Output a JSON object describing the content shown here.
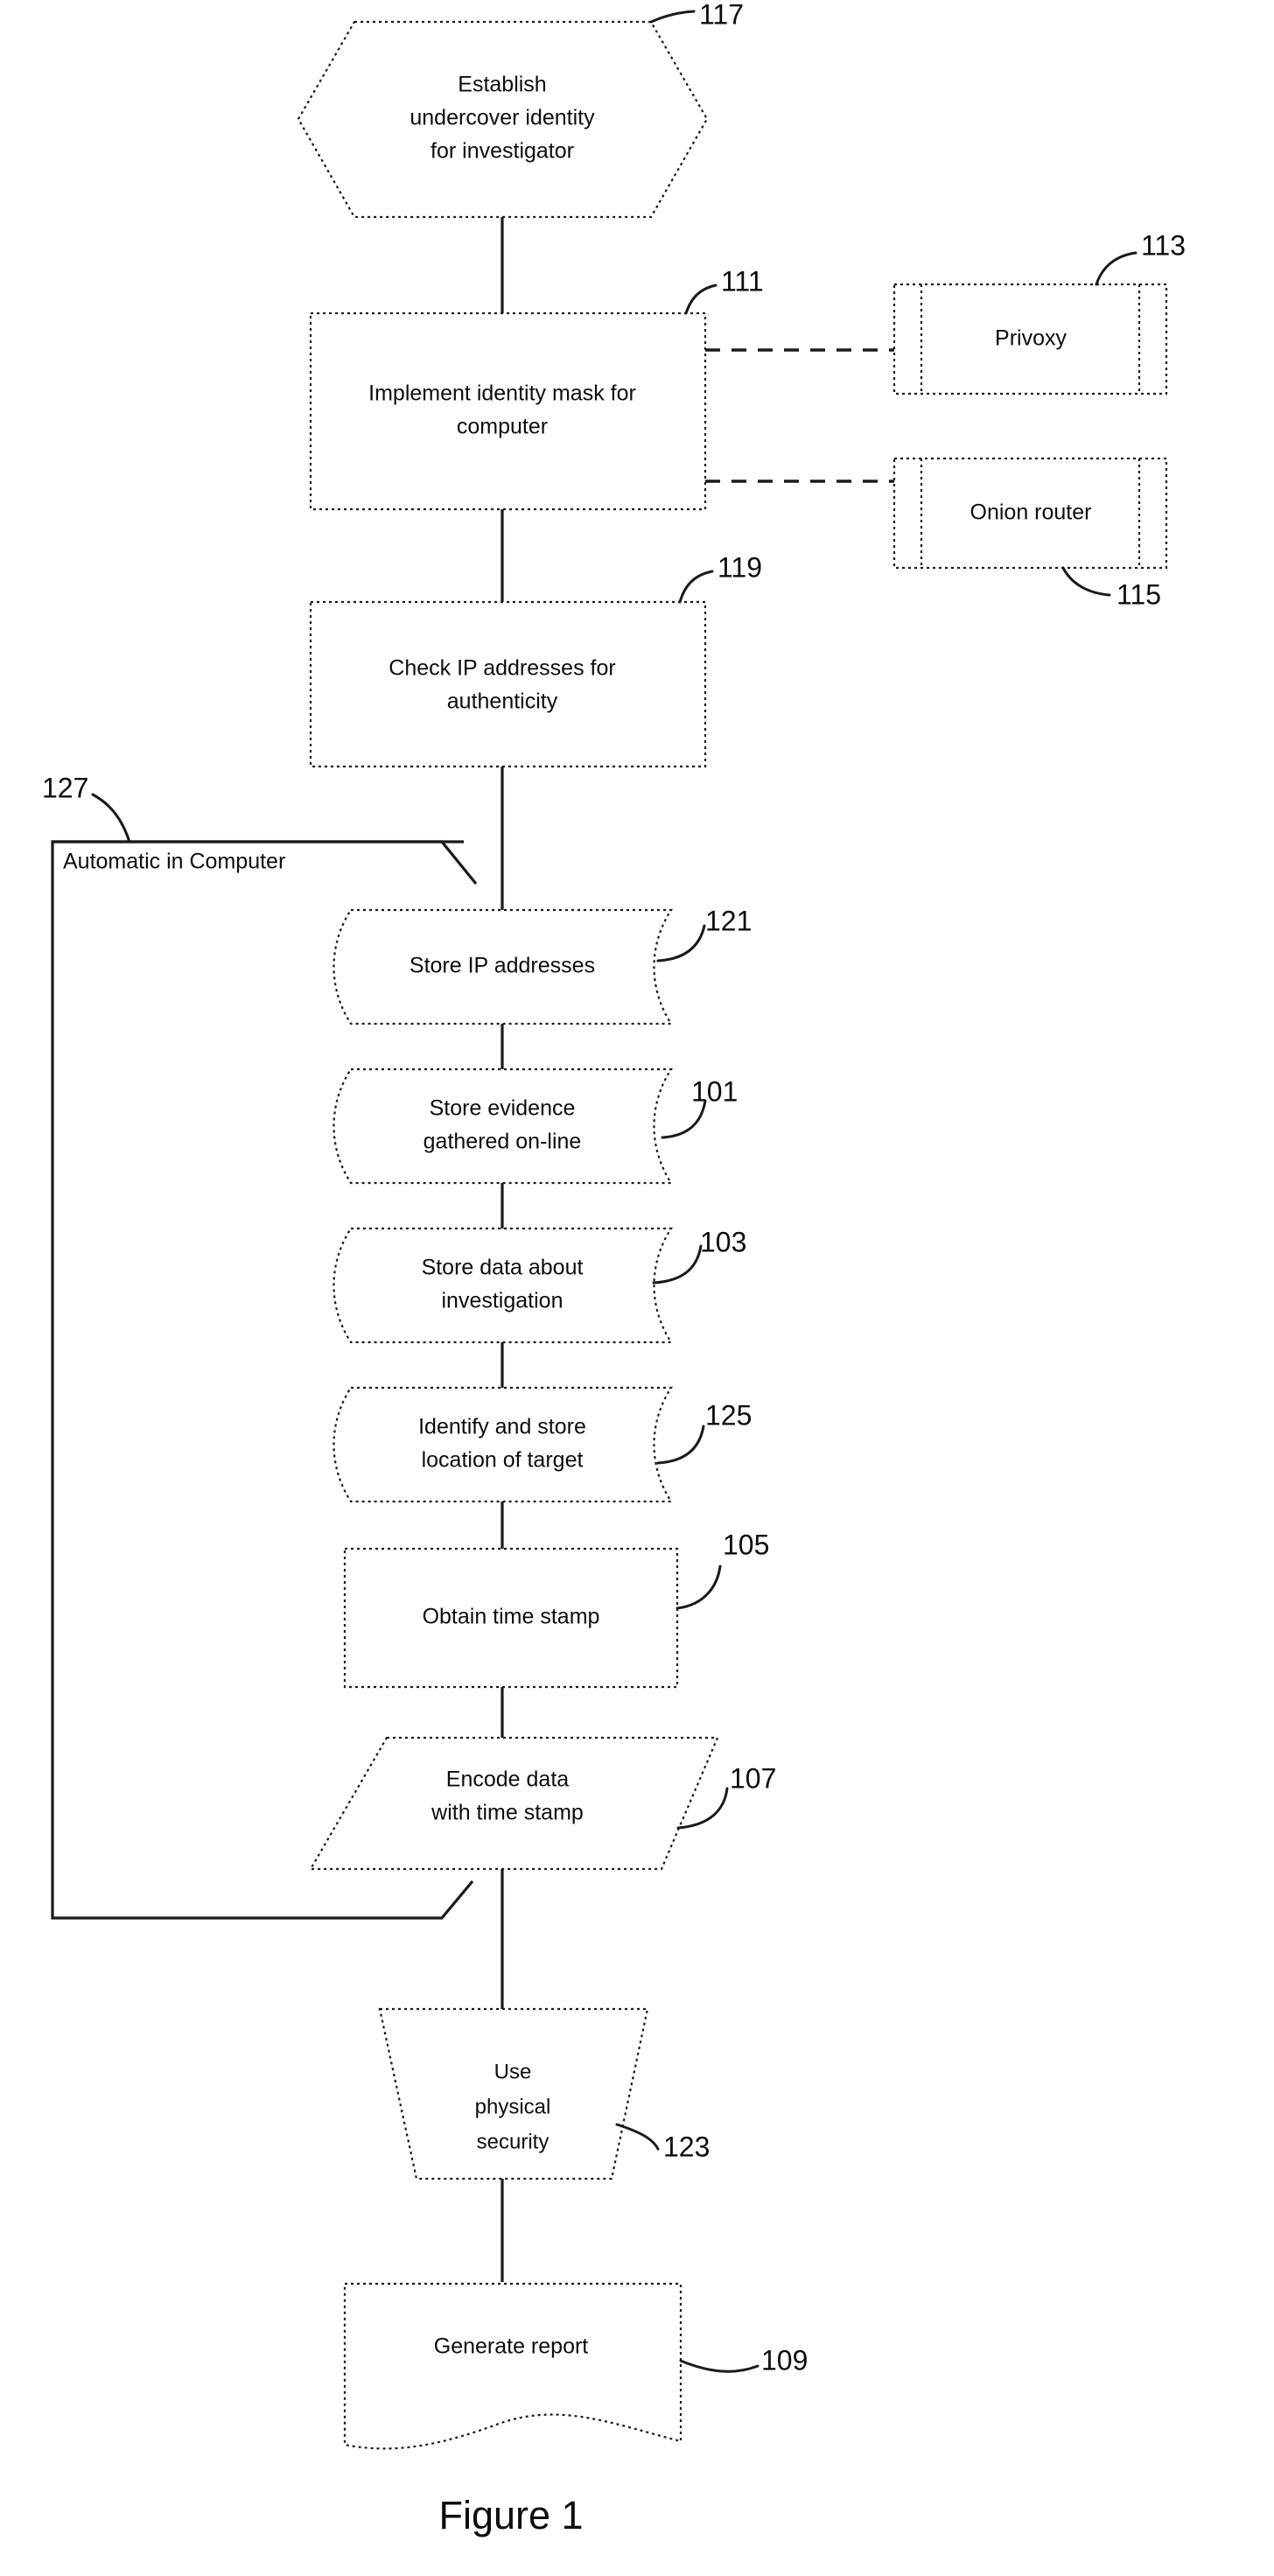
{
  "figure": {
    "caption": "Figure 1"
  },
  "container": {
    "label": "Automatic in Computer",
    "ref": "127"
  },
  "nodes": {
    "establish_identity": {
      "lines": [
        "Establish",
        "undercover identity",
        "for investigator"
      ],
      "ref": "117",
      "shape": "hexagon"
    },
    "implement_mask": {
      "lines": [
        "Implement identity mask for",
        "computer"
      ],
      "ref": "111",
      "shape": "rectangle"
    },
    "privoxy": {
      "lines": [
        "Privoxy"
      ],
      "ref": "113",
      "shape": "predefined-process"
    },
    "onion_router": {
      "lines": [
        "Onion router"
      ],
      "ref": "115",
      "shape": "predefined-process"
    },
    "check_ip": {
      "lines": [
        "Check IP addresses for",
        "authenticity"
      ],
      "ref": "119",
      "shape": "rectangle"
    },
    "store_ip": {
      "lines": [
        "Store IP addresses"
      ],
      "ref": "121",
      "shape": "stored-data"
    },
    "store_evidence": {
      "lines": [
        "Store evidence",
        "gathered on-line"
      ],
      "ref": "101",
      "shape": "stored-data"
    },
    "store_data": {
      "lines": [
        "Store data about",
        "investigation"
      ],
      "ref": "103",
      "shape": "stored-data"
    },
    "identify_location": {
      "lines": [
        "Identify and store",
        "location of target"
      ],
      "ref": "125",
      "shape": "stored-data"
    },
    "obtain_timestamp": {
      "lines": [
        "Obtain time stamp"
      ],
      "ref": "105",
      "shape": "rectangle"
    },
    "encode_data": {
      "lines": [
        "Encode data",
        "with time stamp"
      ],
      "ref": "107",
      "shape": "parallelogram"
    },
    "physical_security": {
      "lines": [
        "Use",
        "physical",
        "security"
      ],
      "ref": "123",
      "shape": "trapezoid"
    },
    "generate_report": {
      "lines": [
        "Generate report"
      ],
      "ref": "109",
      "shape": "document"
    }
  },
  "colors": {
    "ink": "#1a1a1a",
    "paper": "#ffffff"
  }
}
